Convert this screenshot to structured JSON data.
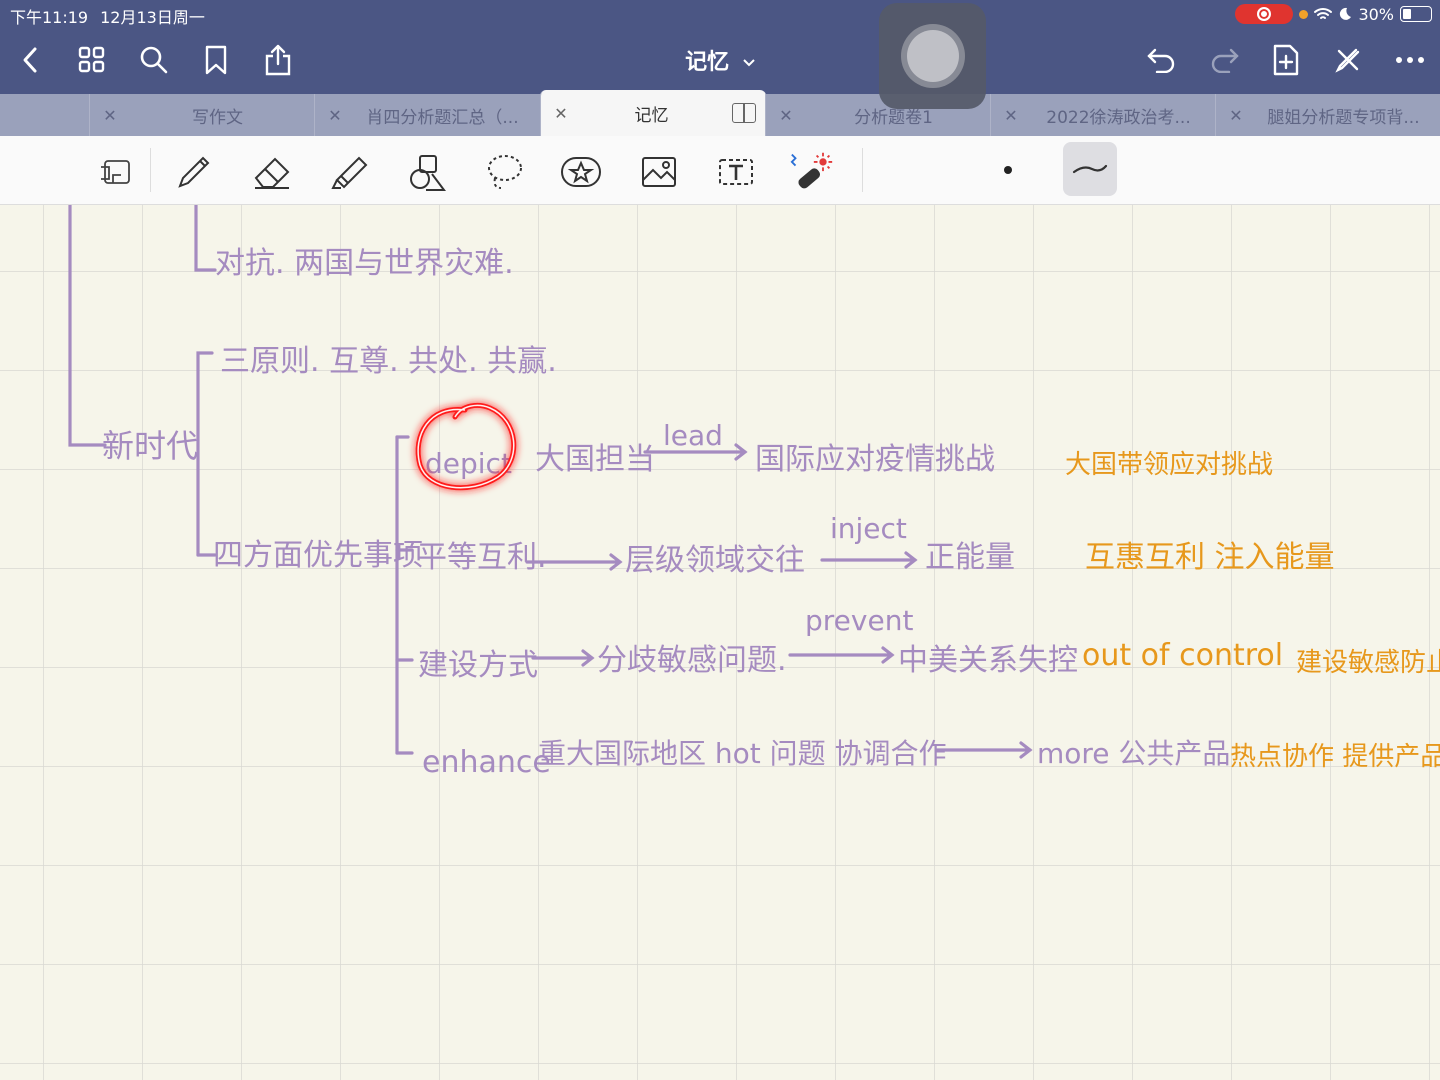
{
  "status": {
    "time": "下午11:19",
    "date": "12月13日周一",
    "battery": "30%"
  },
  "toolbar_nav": {
    "title": "记忆"
  },
  "tabs": [
    {
      "label": "写作文"
    },
    {
      "label": "肖四分析题汇总（..."
    },
    {
      "label": "记忆"
    },
    {
      "label": "分析题卷1"
    },
    {
      "label": "2022徐涛政治考..."
    },
    {
      "label": "腿姐分析题专项背..."
    }
  ],
  "notes": {
    "n1": "对抗. 两国与世界灾难.",
    "n2": "三原则. 互尊. 共处. 共赢.",
    "n3": "新时代",
    "n4": "四方面优先事项",
    "n5": "depict",
    "n6": "大国担当",
    "n7": "lead",
    "n8": "国际应对疫情挑战",
    "n9": "大国带领应对挑战",
    "n10": "平等互利.",
    "n11": "层级领域交往",
    "n12": "inject",
    "n13": "正能量",
    "n14": "互惠互利 注入能量",
    "n15": "建设方式",
    "n16": "分歧敏感问题.",
    "n17": "prevent",
    "n18": "中美关系失控",
    "n19": "out of control",
    "n20": "建设敏感防止",
    "n21": "enhance",
    "n22": "重大国际地区 hot 问题 协调合作",
    "n23": "more 公共产品",
    "n24": "热点协作 提供产品"
  }
}
